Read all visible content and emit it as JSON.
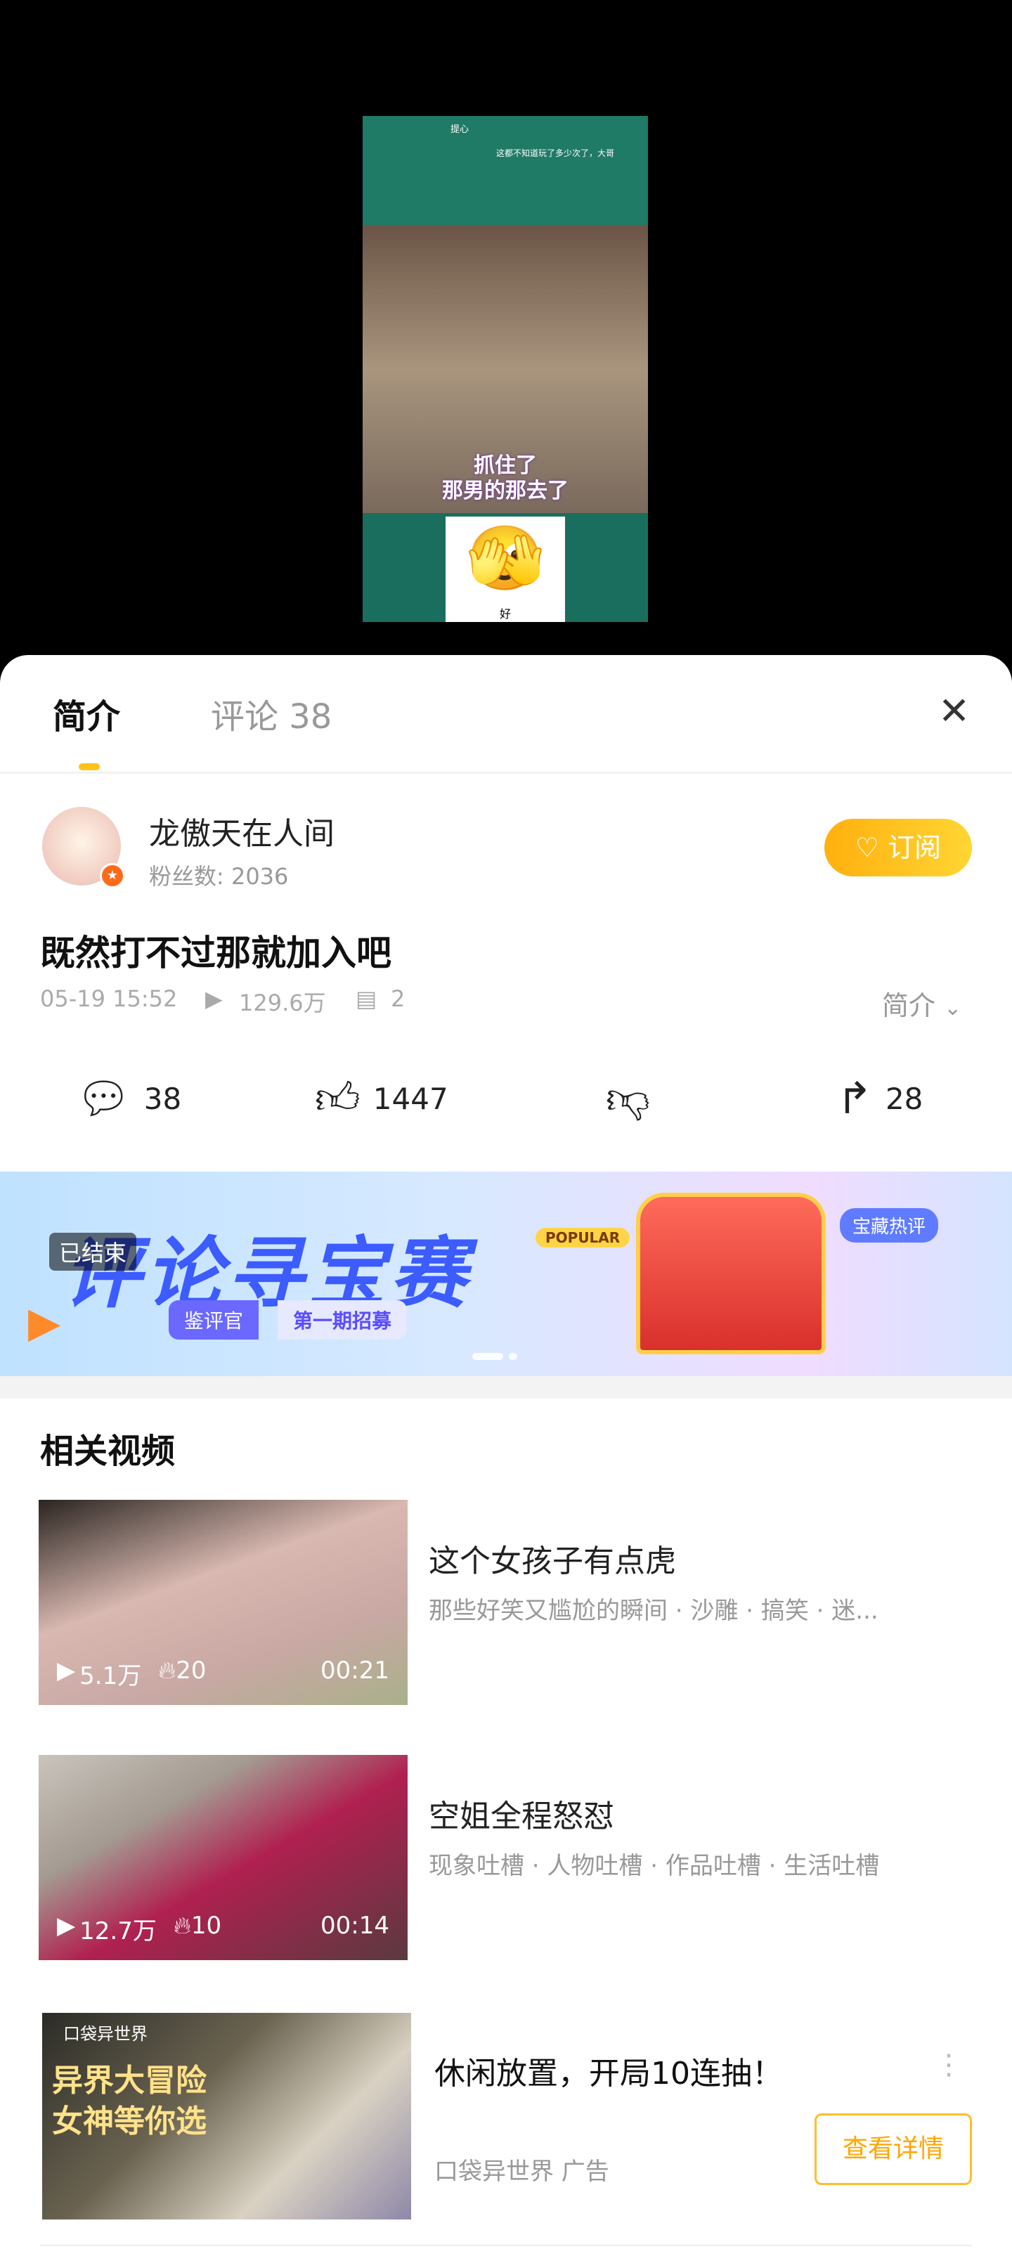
{
  "video": {
    "top_caption": "提心",
    "top_subtitle": "这都不知道玩了多少次了，大哥",
    "caption_line1": "抓住了",
    "caption_line2": "那男的那去了",
    "emoji_label": "好"
  },
  "tabs": [
    {
      "label": "简介",
      "active": true
    },
    {
      "label": "评论 38",
      "active": false
    }
  ],
  "author": {
    "name": "龙傲天在人间",
    "fans": "粉丝数: 2036",
    "subscribe_label": "订阅"
  },
  "post": {
    "title": "既然打不过那就加入吧",
    "time": "05-19 15:52",
    "views": "129.6万",
    "danmaku": "2",
    "intro_toggle": "简介"
  },
  "actions": {
    "comments": "38",
    "likes": "1447",
    "shares": "28"
  },
  "banner": {
    "status": "已结束",
    "title": "评论寻宝赛",
    "tag_popular": "POPULAR",
    "tag_hot": "宝藏热评",
    "role": "鉴评官",
    "recruit": "第一期招募"
  },
  "related": {
    "heading": "相关视频",
    "items": [
      {
        "title": "这个女孩子有点虎",
        "subtitle": "那些好笑又尴尬的瞬间 · 沙雕 · 搞笑 · 迷...",
        "views": "5.1万",
        "hot": "20",
        "duration": "00:21"
      },
      {
        "title": "空姐全程怒怼",
        "subtitle": "现象吐槽 · 人物吐槽 · 作品吐槽 · 生活吐槽",
        "views": "12.7万",
        "hot": "10",
        "duration": "00:14"
      }
    ]
  },
  "ad": {
    "image_logo": "口袋异世界",
    "image_line1": "异界大冒险",
    "image_line2": "女神等你选",
    "title": "休闲放置，开局10连抽！",
    "source": "口袋异世界 广告",
    "button": "查看详情"
  },
  "colors": {
    "accent": "#ffc21a",
    "sheet": "#ffffff",
    "video_bg": "#000000"
  }
}
